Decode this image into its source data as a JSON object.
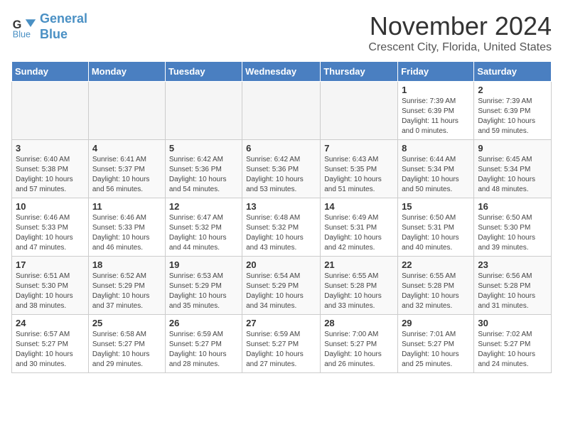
{
  "header": {
    "logo_line1": "General",
    "logo_line2": "Blue",
    "month": "November 2024",
    "location": "Crescent City, Florida, United States"
  },
  "weekdays": [
    "Sunday",
    "Monday",
    "Tuesday",
    "Wednesday",
    "Thursday",
    "Friday",
    "Saturday"
  ],
  "weeks": [
    [
      {
        "day": "",
        "info": ""
      },
      {
        "day": "",
        "info": ""
      },
      {
        "day": "",
        "info": ""
      },
      {
        "day": "",
        "info": ""
      },
      {
        "day": "",
        "info": ""
      },
      {
        "day": "1",
        "info": "Sunrise: 7:39 AM\nSunset: 6:39 PM\nDaylight: 11 hours and 0 minutes."
      },
      {
        "day": "2",
        "info": "Sunrise: 7:39 AM\nSunset: 6:39 PM\nDaylight: 10 hours and 59 minutes."
      }
    ],
    [
      {
        "day": "3",
        "info": "Sunrise: 6:40 AM\nSunset: 5:38 PM\nDaylight: 10 hours and 57 minutes."
      },
      {
        "day": "4",
        "info": "Sunrise: 6:41 AM\nSunset: 5:37 PM\nDaylight: 10 hours and 56 minutes."
      },
      {
        "day": "5",
        "info": "Sunrise: 6:42 AM\nSunset: 5:36 PM\nDaylight: 10 hours and 54 minutes."
      },
      {
        "day": "6",
        "info": "Sunrise: 6:42 AM\nSunset: 5:36 PM\nDaylight: 10 hours and 53 minutes."
      },
      {
        "day": "7",
        "info": "Sunrise: 6:43 AM\nSunset: 5:35 PM\nDaylight: 10 hours and 51 minutes."
      },
      {
        "day": "8",
        "info": "Sunrise: 6:44 AM\nSunset: 5:34 PM\nDaylight: 10 hours and 50 minutes."
      },
      {
        "day": "9",
        "info": "Sunrise: 6:45 AM\nSunset: 5:34 PM\nDaylight: 10 hours and 48 minutes."
      }
    ],
    [
      {
        "day": "10",
        "info": "Sunrise: 6:46 AM\nSunset: 5:33 PM\nDaylight: 10 hours and 47 minutes."
      },
      {
        "day": "11",
        "info": "Sunrise: 6:46 AM\nSunset: 5:33 PM\nDaylight: 10 hours and 46 minutes."
      },
      {
        "day": "12",
        "info": "Sunrise: 6:47 AM\nSunset: 5:32 PM\nDaylight: 10 hours and 44 minutes."
      },
      {
        "day": "13",
        "info": "Sunrise: 6:48 AM\nSunset: 5:32 PM\nDaylight: 10 hours and 43 minutes."
      },
      {
        "day": "14",
        "info": "Sunrise: 6:49 AM\nSunset: 5:31 PM\nDaylight: 10 hours and 42 minutes."
      },
      {
        "day": "15",
        "info": "Sunrise: 6:50 AM\nSunset: 5:31 PM\nDaylight: 10 hours and 40 minutes."
      },
      {
        "day": "16",
        "info": "Sunrise: 6:50 AM\nSunset: 5:30 PM\nDaylight: 10 hours and 39 minutes."
      }
    ],
    [
      {
        "day": "17",
        "info": "Sunrise: 6:51 AM\nSunset: 5:30 PM\nDaylight: 10 hours and 38 minutes."
      },
      {
        "day": "18",
        "info": "Sunrise: 6:52 AM\nSunset: 5:29 PM\nDaylight: 10 hours and 37 minutes."
      },
      {
        "day": "19",
        "info": "Sunrise: 6:53 AM\nSunset: 5:29 PM\nDaylight: 10 hours and 35 minutes."
      },
      {
        "day": "20",
        "info": "Sunrise: 6:54 AM\nSunset: 5:29 PM\nDaylight: 10 hours and 34 minutes."
      },
      {
        "day": "21",
        "info": "Sunrise: 6:55 AM\nSunset: 5:28 PM\nDaylight: 10 hours and 33 minutes."
      },
      {
        "day": "22",
        "info": "Sunrise: 6:55 AM\nSunset: 5:28 PM\nDaylight: 10 hours and 32 minutes."
      },
      {
        "day": "23",
        "info": "Sunrise: 6:56 AM\nSunset: 5:28 PM\nDaylight: 10 hours and 31 minutes."
      }
    ],
    [
      {
        "day": "24",
        "info": "Sunrise: 6:57 AM\nSunset: 5:27 PM\nDaylight: 10 hours and 30 minutes."
      },
      {
        "day": "25",
        "info": "Sunrise: 6:58 AM\nSunset: 5:27 PM\nDaylight: 10 hours and 29 minutes."
      },
      {
        "day": "26",
        "info": "Sunrise: 6:59 AM\nSunset: 5:27 PM\nDaylight: 10 hours and 28 minutes."
      },
      {
        "day": "27",
        "info": "Sunrise: 6:59 AM\nSunset: 5:27 PM\nDaylight: 10 hours and 27 minutes."
      },
      {
        "day": "28",
        "info": "Sunrise: 7:00 AM\nSunset: 5:27 PM\nDaylight: 10 hours and 26 minutes."
      },
      {
        "day": "29",
        "info": "Sunrise: 7:01 AM\nSunset: 5:27 PM\nDaylight: 10 hours and 25 minutes."
      },
      {
        "day": "30",
        "info": "Sunrise: 7:02 AM\nSunset: 5:27 PM\nDaylight: 10 hours and 24 minutes."
      }
    ]
  ]
}
